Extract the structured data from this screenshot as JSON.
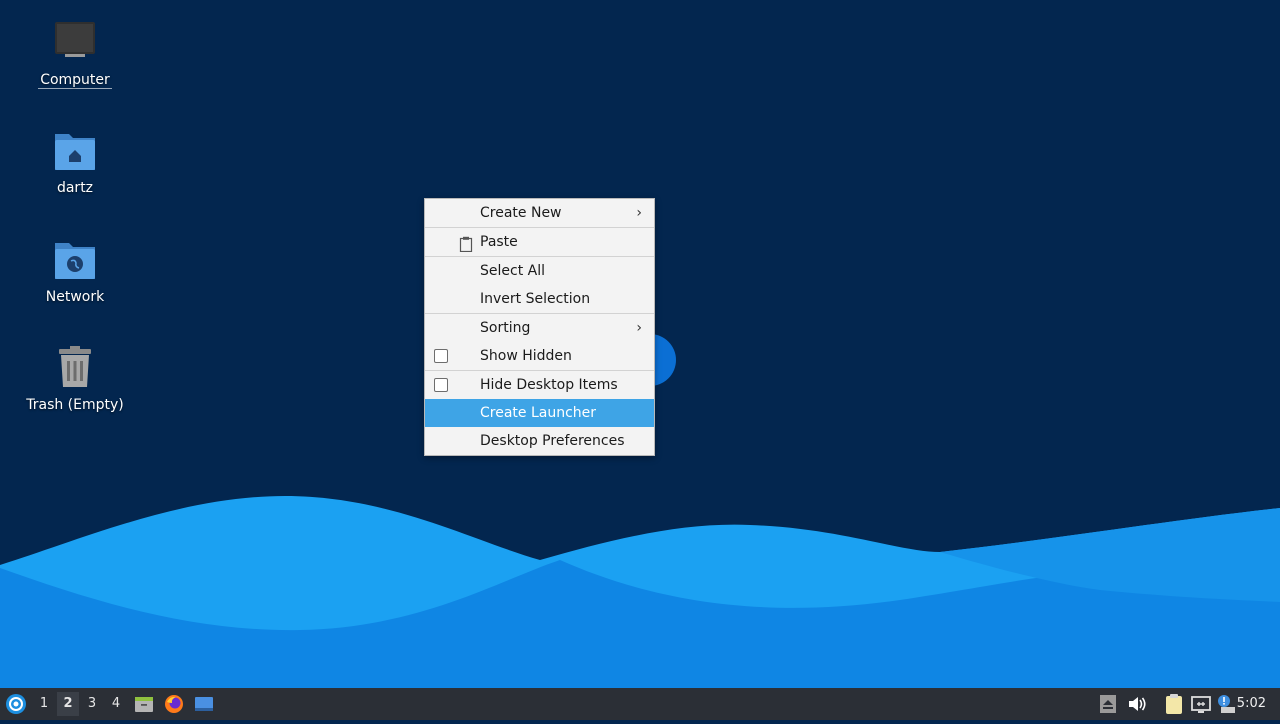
{
  "desktop": {
    "icons": [
      {
        "label": "Computer",
        "icon": "computer-icon"
      },
      {
        "label": "dartz",
        "icon": "home-folder-icon"
      },
      {
        "label": "Network",
        "icon": "network-folder-icon"
      },
      {
        "label": "Trash (Empty)",
        "icon": "trash-icon"
      }
    ]
  },
  "context_menu": {
    "items": [
      {
        "label": "Create New",
        "submenu": true
      },
      {
        "label": "Paste",
        "icon": "paste-icon"
      },
      {
        "label": "Select All"
      },
      {
        "label": "Invert Selection"
      },
      {
        "label": "Sorting",
        "submenu": true
      },
      {
        "label": "Show Hidden",
        "checked": false
      },
      {
        "label": "Hide Desktop Items",
        "checked": false
      },
      {
        "label": "Create Launcher",
        "highlighted": true
      },
      {
        "label": "Desktop Preferences"
      }
    ]
  },
  "panel": {
    "workspaces": [
      "1",
      "2",
      "3",
      "4"
    ],
    "current_workspace": "2",
    "launchers": [
      "file-manager-icon",
      "firefox-icon",
      "show-desktop-icon"
    ],
    "tray": [
      "eject-icon",
      "volume-icon",
      "clipboard-icon",
      "network-icon",
      "notification-icon"
    ],
    "clock": "5:02"
  },
  "colors": {
    "wallpaper_dark": "#03264f",
    "wave_light": "#1ba1f2",
    "wave_mid": "#0f86e4",
    "highlight": "#3ea4e6",
    "panel": "#2b2f36"
  }
}
